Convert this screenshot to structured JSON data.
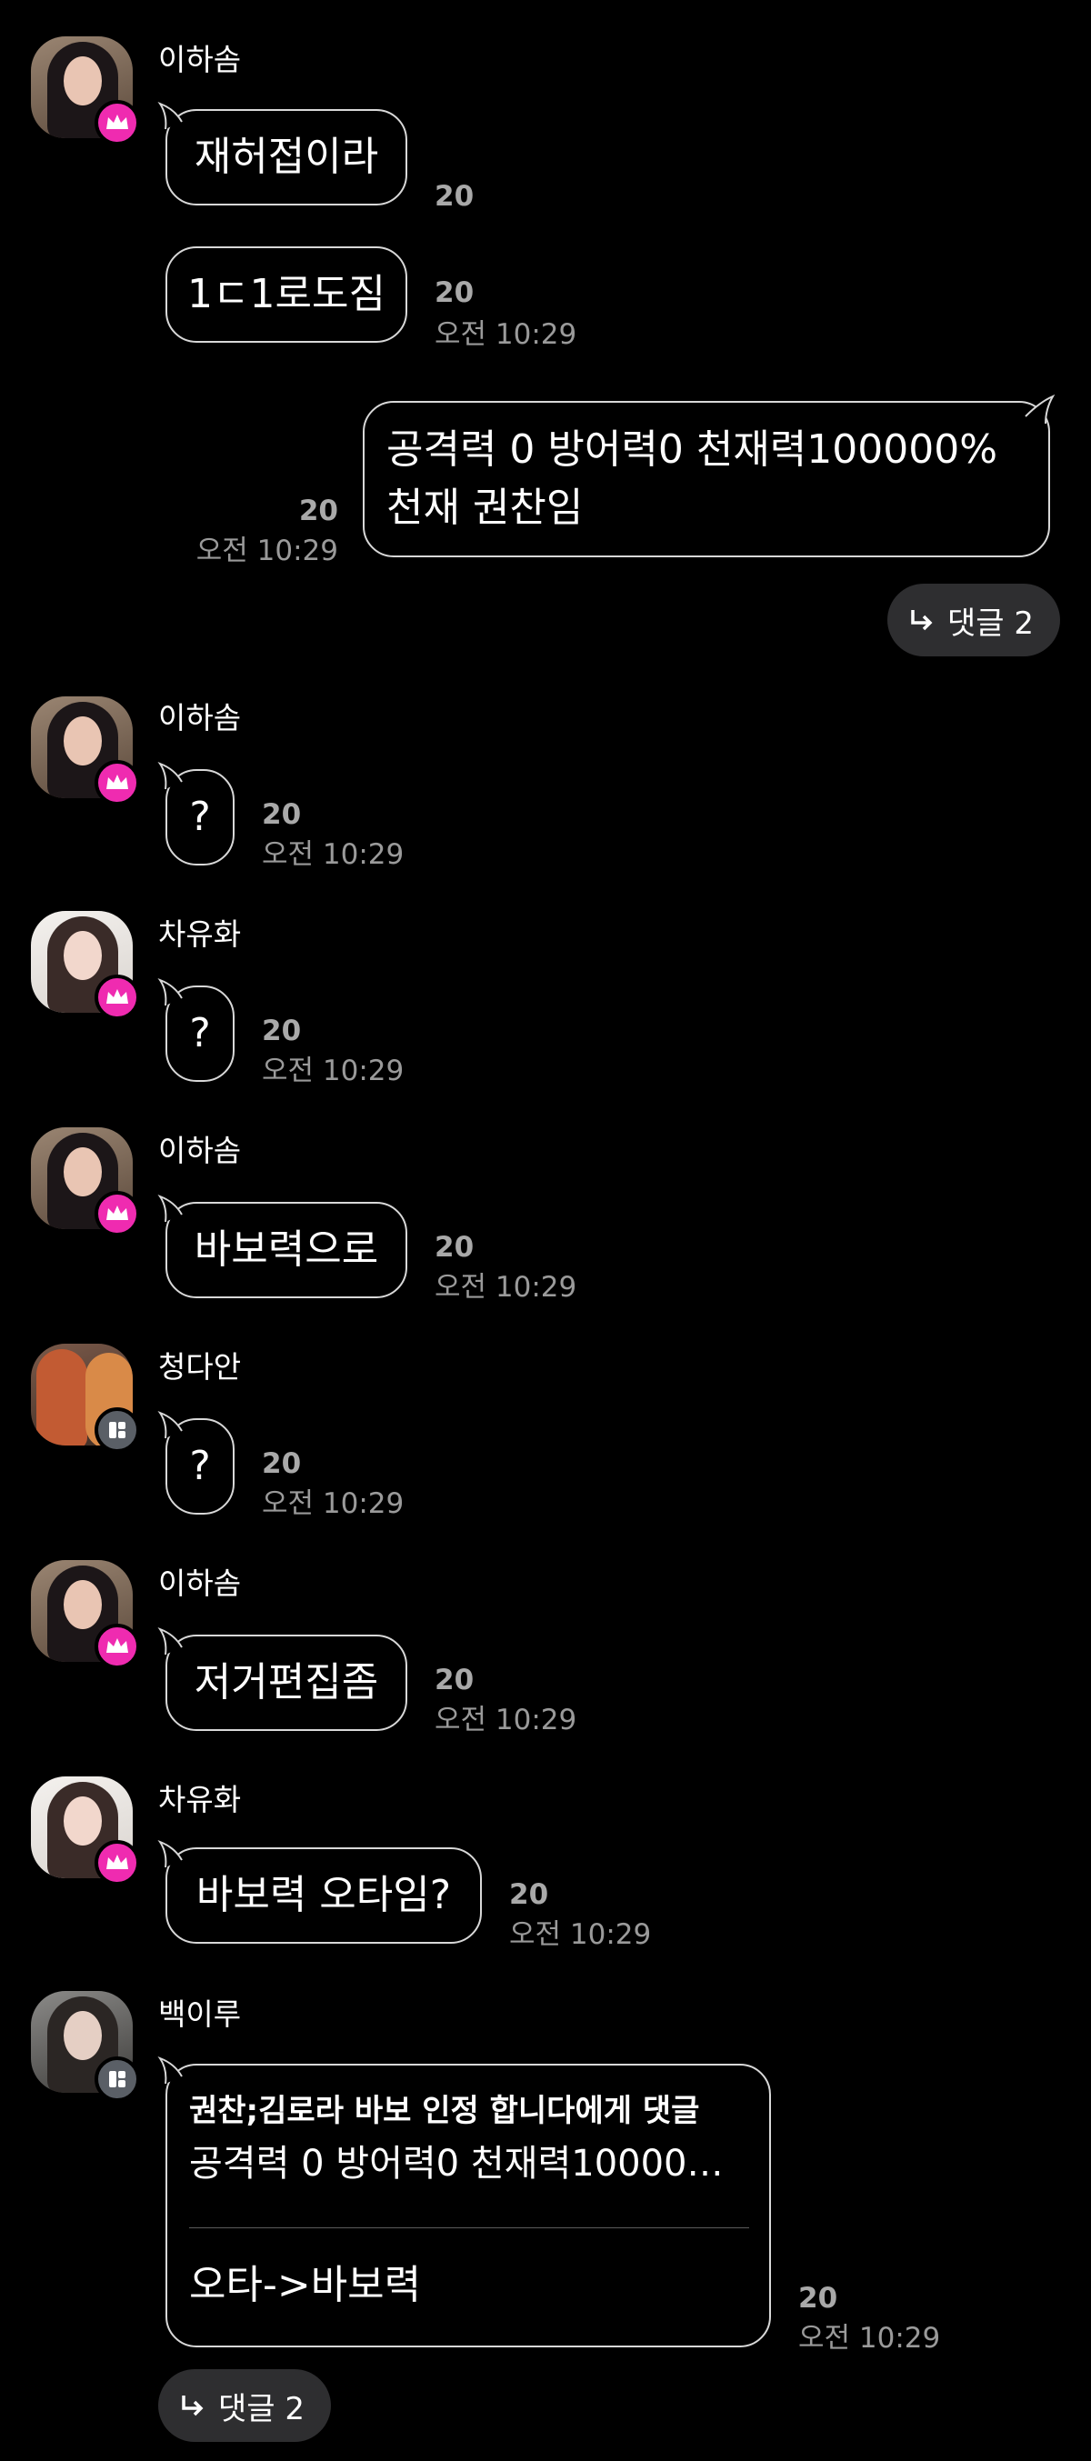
{
  "messages": [
    {
      "sender": "이하솜",
      "texts": [
        "재허접이라",
        "1ㄷ1로도짐"
      ],
      "count": "20",
      "time": "오전 10:29"
    },
    {
      "sender": "me",
      "lines": [
        "공격력 0 방어력0 천재력100000%",
        "천재 권찬임"
      ],
      "count": "20",
      "time": "오전 10:29",
      "reply_label": "댓글 2"
    },
    {
      "sender": "이하솜",
      "text": "?",
      "count": "20",
      "time": "오전 10:29"
    },
    {
      "sender": "차유화",
      "text": "?",
      "count": "20",
      "time": "오전 10:29"
    },
    {
      "sender": "이하솜",
      "text": "바보력으로",
      "count": "20",
      "time": "오전 10:29"
    },
    {
      "sender": "청다안",
      "text": "?",
      "count": "20",
      "time": "오전 10:29"
    },
    {
      "sender": "이하솜",
      "text": "저거편집좀",
      "count": "20",
      "time": "오전 10:29"
    },
    {
      "sender": "차유화",
      "text": "바보력 오타임?",
      "count": "20",
      "time": "오전 10:29"
    },
    {
      "sender": "백이루",
      "quote_title": "권찬;김로라 바보 인정 합니다에게 댓글",
      "quote_body": "공격력 0 방어력0 천재력100000...",
      "text": "오타->바보력",
      "count": "20",
      "time": "오전 10:29",
      "reply_label": "댓글 2"
    }
  ],
  "colors": {
    "background": "#000000",
    "bubble_border": "#d8d8d8",
    "crown_badge": "#ef2bb0",
    "grid_badge": "#5a5f66",
    "meta_text": "#a9a9a9",
    "reply_pill": "#2e2e30"
  },
  "icons": {
    "crown": "crown-icon",
    "grid": "grid-icon",
    "reply_arrow": "reply-arrow-icon"
  }
}
